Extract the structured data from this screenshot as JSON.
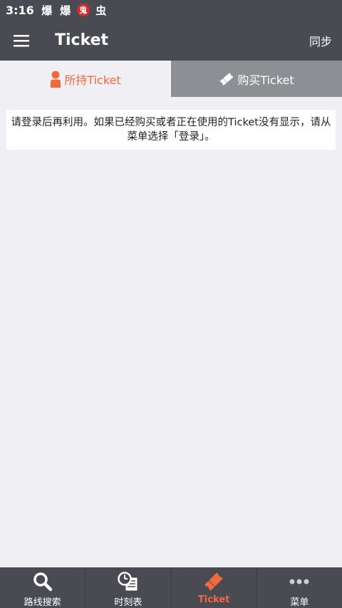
{
  "status_bar": {
    "time": "3:16",
    "icons": [
      {
        "name": "notification-icon-1",
        "glyph": "爆"
      },
      {
        "name": "notification-icon-2",
        "glyph": "爆"
      },
      {
        "name": "notification-icon-3",
        "glyph": "鬼"
      },
      {
        "name": "notification-icon-4",
        "glyph": "虫"
      }
    ]
  },
  "app_bar": {
    "title": "Ticket",
    "sync_label": "同步"
  },
  "tabs": [
    {
      "label": "所持Ticket",
      "icon": "person-icon",
      "active": true
    },
    {
      "label": "购买Ticket",
      "icon": "ticket-icon",
      "active": false
    }
  ],
  "notice": {
    "text": "请登录后再利用。如果已经购买或者正在使用的Ticket没有显示，请从菜单选择「登录」。"
  },
  "bottom_nav": [
    {
      "label": "路线搜索",
      "icon": "search-icon",
      "active": false
    },
    {
      "label": "时刻表",
      "icon": "timetable-icon",
      "active": false
    },
    {
      "label": "Ticket",
      "icon": "ticket-icon",
      "active": true
    },
    {
      "label": "菜单",
      "icon": "more-icon",
      "active": false
    }
  ],
  "colors": {
    "bar_background": "#4a4b52",
    "accent": "#f06a3d",
    "inactive_tab": "#8e8f94",
    "page_background": "#efeff4"
  }
}
